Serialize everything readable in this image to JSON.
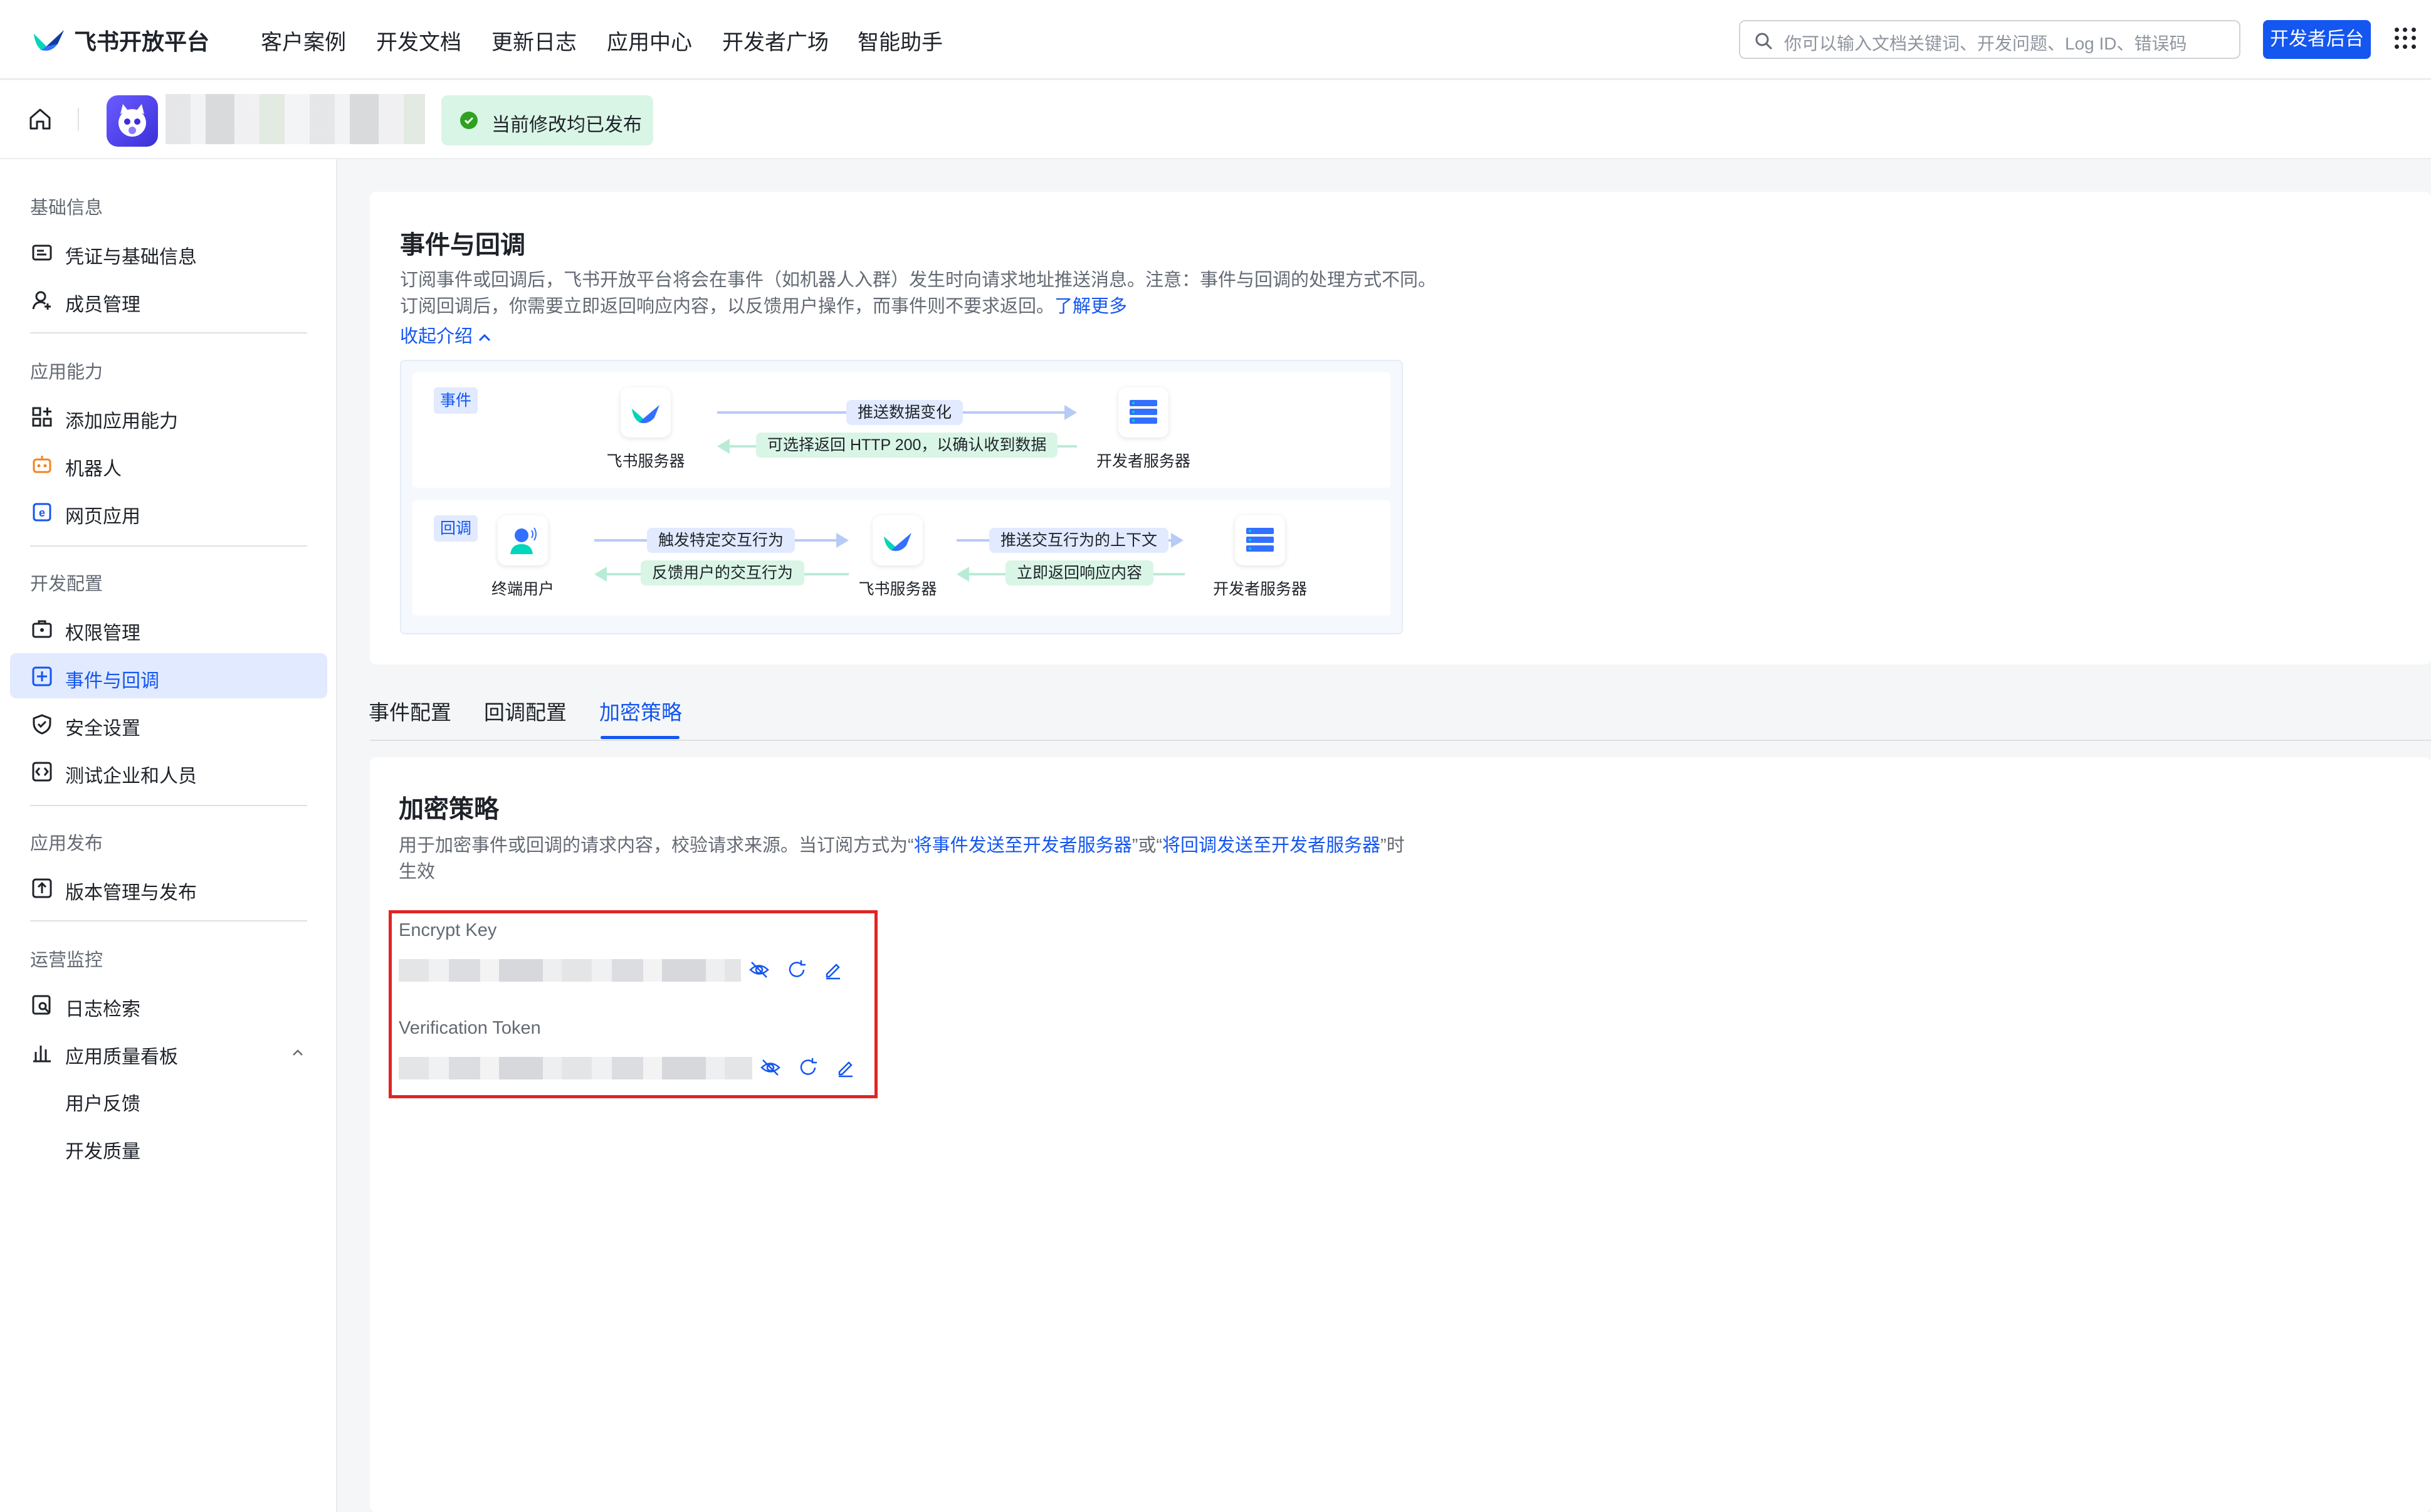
{
  "topnav": {
    "brand": "飞书开放平台",
    "links": [
      "客户案例",
      "开发文档",
      "更新日志",
      "应用中心",
      "开发者广场",
      "智能助手"
    ],
    "search_placeholder": "你可以输入文档关键词、开发问题、Log ID、错误码",
    "dev_console_label": "开发者后台"
  },
  "appbar": {
    "publish_status": "当前修改均已发布"
  },
  "sidebar": {
    "sections": [
      {
        "title": "基础信息",
        "items": [
          "凭证与基础信息",
          "成员管理"
        ]
      },
      {
        "title": "应用能力",
        "items": [
          "添加应用能力",
          "机器人",
          "网页应用"
        ]
      },
      {
        "title": "开发配置",
        "items": [
          "权限管理",
          "事件与回调",
          "安全设置",
          "测试企业和人员"
        ]
      },
      {
        "title": "应用发布",
        "items": [
          "版本管理与发布"
        ]
      },
      {
        "title": "运营监控",
        "items": [
          "日志检索",
          "应用质量看板"
        ]
      }
    ],
    "subitems": [
      "用户反馈",
      "开发质量"
    ],
    "active_item": "事件与回调"
  },
  "intro": {
    "title": "事件与回调",
    "desc_line1": "订阅事件或回调后，飞书开放平台将会在事件（如机器人入群）发生时向请求地址推送消息。注意：事件与回调的处理方式不同。",
    "desc_line2": "订阅回调后，你需要立即返回响应内容，以反馈用户操作，而事件则不要求返回。",
    "learn_more": "了解更多",
    "collapse": "收起介绍",
    "event_lane": {
      "tag": "事件",
      "node_left": "飞书服务器",
      "node_right": "开发者服务器",
      "arrow_top": "推送数据变化",
      "arrow_bottom": "可选择返回 HTTP 200，以确认收到数据"
    },
    "callback_lane": {
      "tag": "回调",
      "node_user": "终端用户",
      "node_mid": "飞书服务器",
      "node_right": "开发者服务器",
      "arrow_a": "触发特定交互行为",
      "arrow_b": "反馈用户的交互行为",
      "arrow_c": "推送交互行为的上下文",
      "arrow_d": "立即返回响应内容"
    }
  },
  "tabs": [
    "事件配置",
    "回调配置",
    "加密策略"
  ],
  "active_tab": "加密策略",
  "encryption": {
    "title": "加密策略",
    "desc_part1": "用于加密事件或回调的请求内容，校验请求来源。当订阅方式为“",
    "desc_link1": "将事件发送至开发者服务器",
    "desc_part2": "”或“",
    "desc_link2": "将回调发送至开发者服务器",
    "desc_part3": "”时",
    "desc_line2": "生效",
    "encrypt_key_label": "Encrypt Key",
    "verification_token_label": "Verification Token"
  },
  "colors": {
    "accent": "#1456f0",
    "success_bg": "#d9f5e6",
    "highlight_box": "#e02424"
  }
}
